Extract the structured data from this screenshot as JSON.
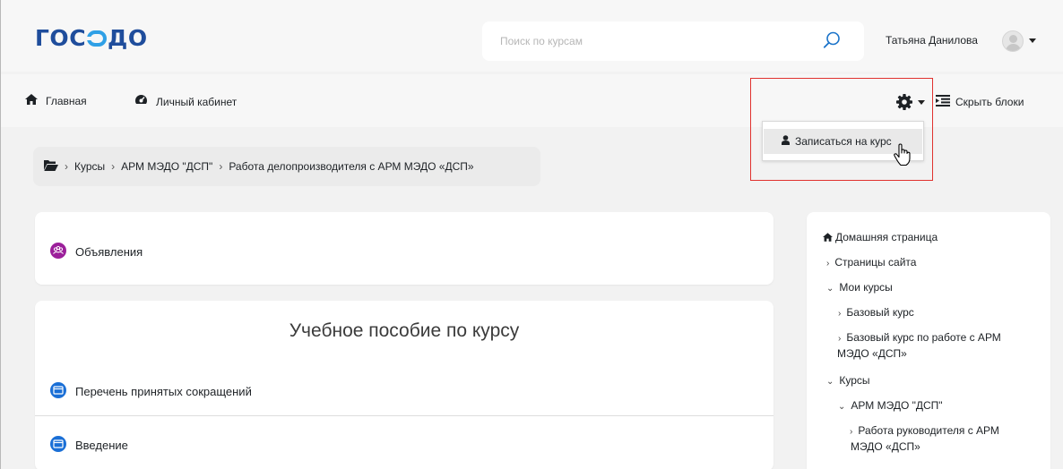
{
  "header": {
    "logo_text": "ГОСЭДО",
    "logo_part1": "ГО",
    "logo_part2": "ДО",
    "search": {
      "placeholder": "Поиск по курсам"
    },
    "user": {
      "name": "Татьяна Данилова"
    }
  },
  "navbar": {
    "home_label": "Главная",
    "cabinet_label": "Личный кабинет",
    "hide_blocks_label": "Скрыть блоки"
  },
  "dropdown": {
    "items": [
      {
        "label": "Записаться на курс"
      }
    ]
  },
  "breadcrumb": {
    "items": [
      "Курсы",
      "АРМ МЭДО \"ДСП\"",
      "Работа делопроизводителя с АРМ МЭДО «ДСП»"
    ]
  },
  "main": {
    "announcements_label": "Объявления",
    "section_title": "Учебное пособие по курсу",
    "activities": [
      "Перечень принятых сокращений",
      "Введение"
    ]
  },
  "sidebar": {
    "items": [
      {
        "label": "Домашняя страница"
      },
      {
        "label": "Страницы сайта"
      },
      {
        "label": "Мои курсы"
      },
      {
        "label": "Базовый курс"
      },
      {
        "label": "Базовый курс по работе с АРМ",
        "label2": "МЭДО «ДСП»"
      },
      {
        "label": "Курсы"
      },
      {
        "label": "АРМ МЭДО \"ДСП\""
      },
      {
        "label": "Работа руководителя с АРМ",
        "label2": "МЭДО «ДСП»"
      }
    ]
  },
  "colors": {
    "brand": "#1f4d9c",
    "brand_accent": "#2fa0e6",
    "highlight": "#e0322f",
    "forum_icon": "#9b1f9a",
    "page_icon": "#1a6fd6"
  }
}
